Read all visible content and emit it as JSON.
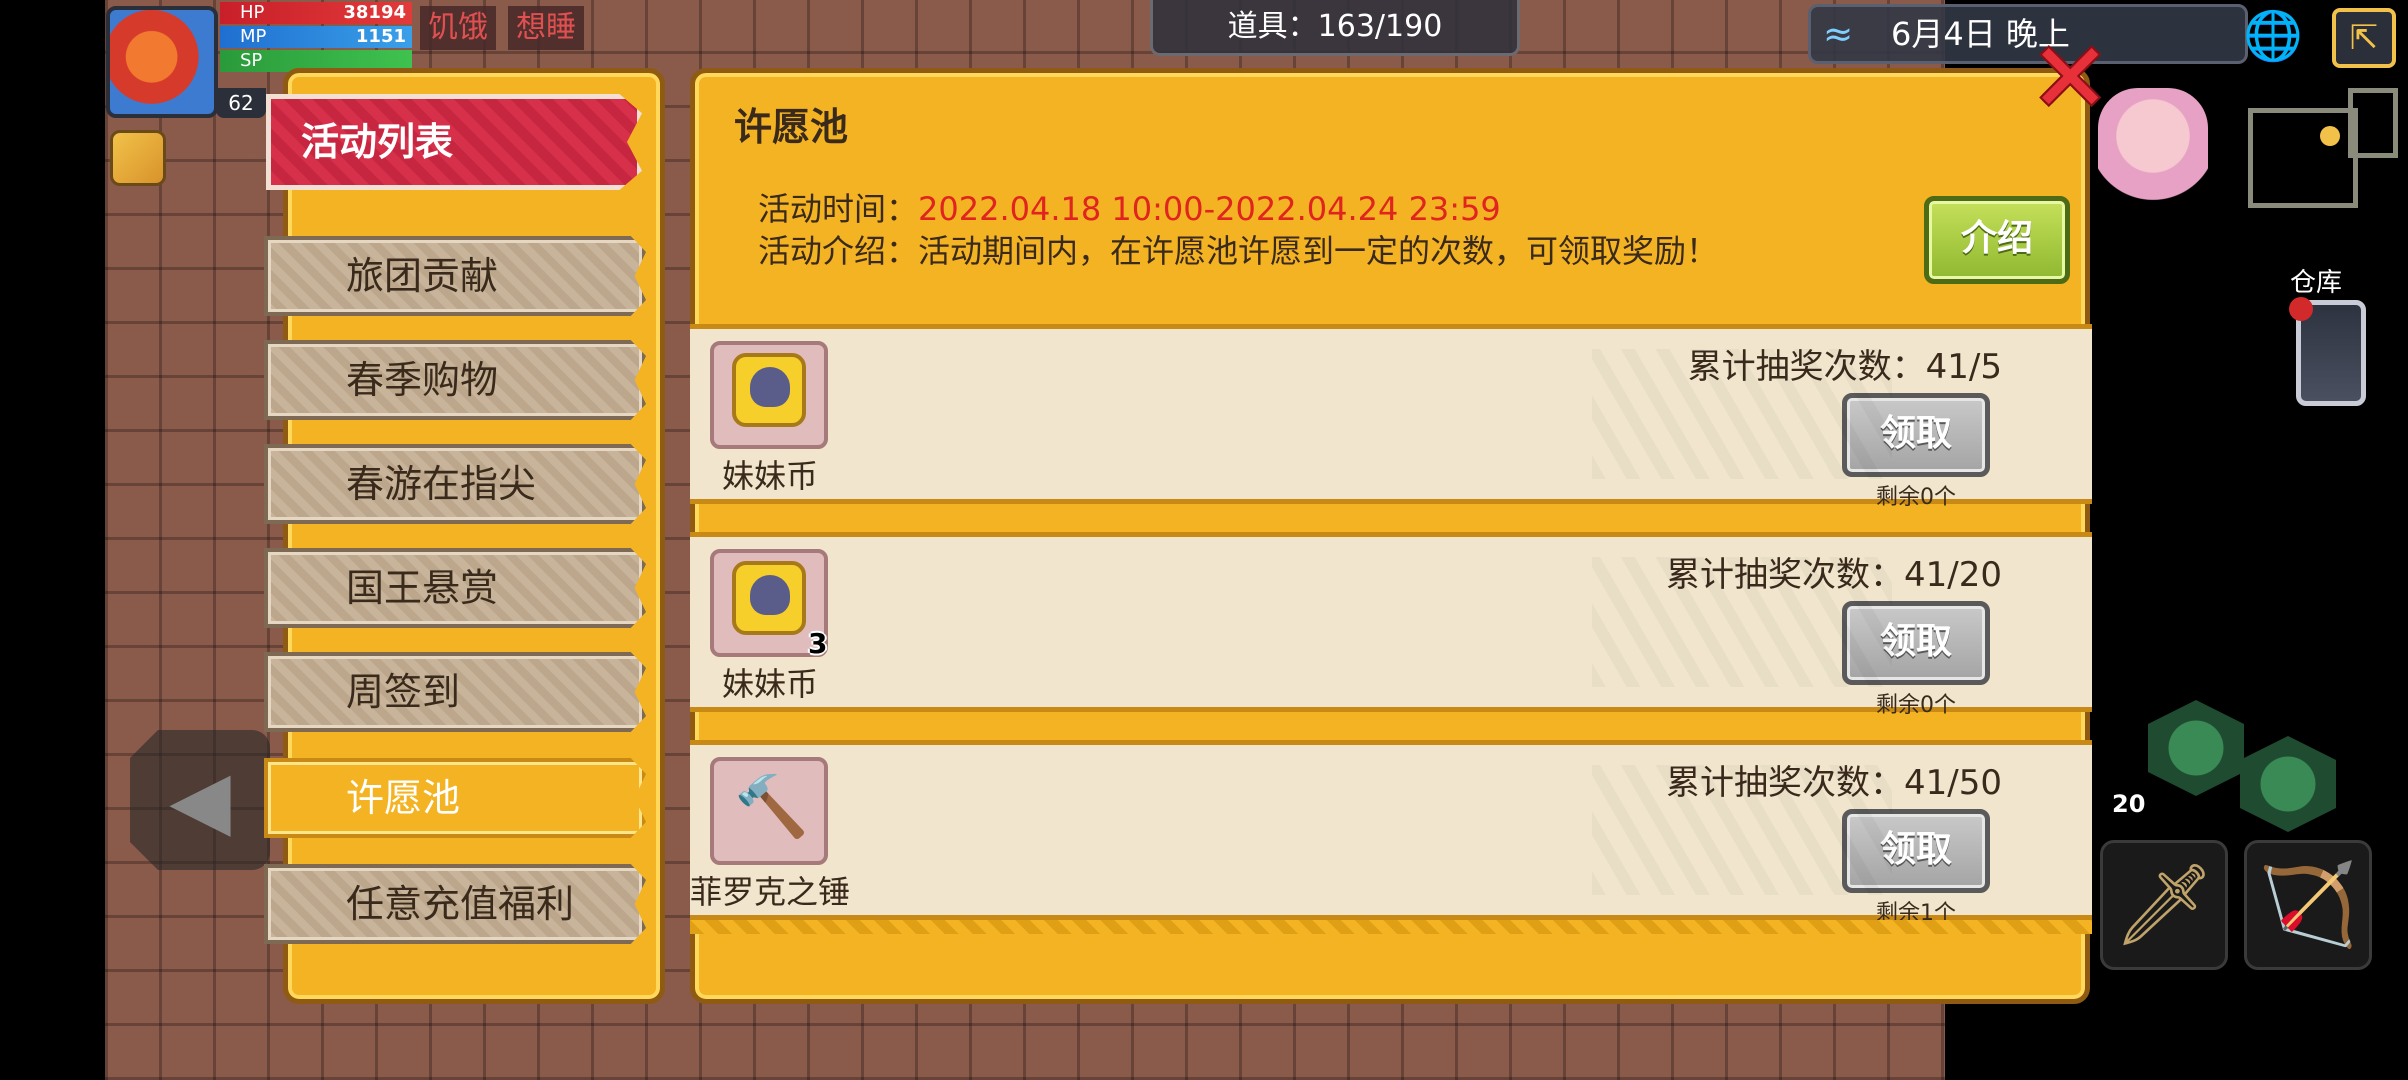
{
  "hud": {
    "level": "62",
    "hp_label": "HP",
    "hp_value": "38194",
    "mp_label": "MP",
    "mp_value": "1151",
    "sp_label": "SP",
    "sp_value": "",
    "status_hungry": "饥饿",
    "status_sleepy": "想睡"
  },
  "top": {
    "item_count": "道具：163/190",
    "date": "6月4日 晚上",
    "warehouse_label": "仓库",
    "skill_count": "20"
  },
  "sidebar": {
    "header": "活动列表",
    "items": [
      {
        "label": "旅团贡献"
      },
      {
        "label": "春季购物"
      },
      {
        "label": "春游在指尖"
      },
      {
        "label": "国王悬赏"
      },
      {
        "label": "周签到"
      },
      {
        "label": "许愿池"
      },
      {
        "label": "任意充值福利"
      }
    ]
  },
  "main": {
    "title": "许愿池",
    "time_label": "活动时间：",
    "time_value": "2022.04.18 10:00-2022.04.24 23:59",
    "desc_label": "活动介绍：",
    "desc_value": "活动期间内，在许愿池许愿到一定的次数，可领取奖励！",
    "intro_button": "介绍",
    "rewards": [
      {
        "item_name": "妹妹币",
        "qty": "",
        "draw_count": "累计抽奖次数：41/5",
        "claim": "领取",
        "remain": "剩余0个"
      },
      {
        "item_name": "妹妹币",
        "qty": "3",
        "draw_count": "累计抽奖次数：41/20",
        "claim": "领取",
        "remain": "剩余0个"
      },
      {
        "item_name": "菲罗克之锤",
        "qty": "",
        "draw_count": "累计抽奖次数：41/50",
        "claim": "领取",
        "remain": "剩余1个"
      }
    ]
  },
  "colors": {
    "panel_gold": "#f4b323",
    "header_red": "#d6304a",
    "time_red": "#e0241f",
    "intro_green": "#8fb830"
  },
  "icons": {
    "close": "close-icon",
    "globe": "globe-icon",
    "exit": "exit-icon",
    "weather": "wave-icon"
  }
}
